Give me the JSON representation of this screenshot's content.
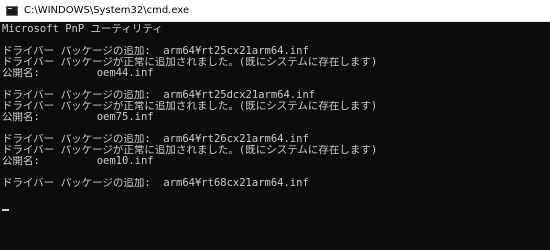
{
  "window": {
    "title": "C:\\WINDOWS\\System32\\cmd.exe"
  },
  "console": {
    "lines": [
      "Microsoft PnP ユーティリティ",
      "",
      "ドライバー パッケージの追加:  arm64¥rt25cx21arm64.inf",
      "ドライバー パッケージが正常に追加されました。(既にシステムに存在します)",
      "公開名:         oem44.inf",
      "",
      "ドライバー パッケージの追加:  arm64¥rt25dcx21arm64.inf",
      "ドライバー パッケージが正常に追加されました。(既にシステムに存在します)",
      "公開名:         oem75.inf",
      "",
      "ドライバー パッケージの追加:  arm64¥rt26cx21arm64.inf",
      "ドライバー パッケージが正常に追加されました。(既にシステムに存在します)",
      "公開名:         oem10.inf",
      "",
      "ドライバー パッケージの追加:  arm64¥rt68cx21arm64.inf",
      ""
    ]
  },
  "colors": {
    "console_background": "#0c0c0c",
    "console_text": "#cccccc",
    "titlebar_background": "#ffffff"
  },
  "icons": {
    "title_icon": "cmd-icon"
  }
}
